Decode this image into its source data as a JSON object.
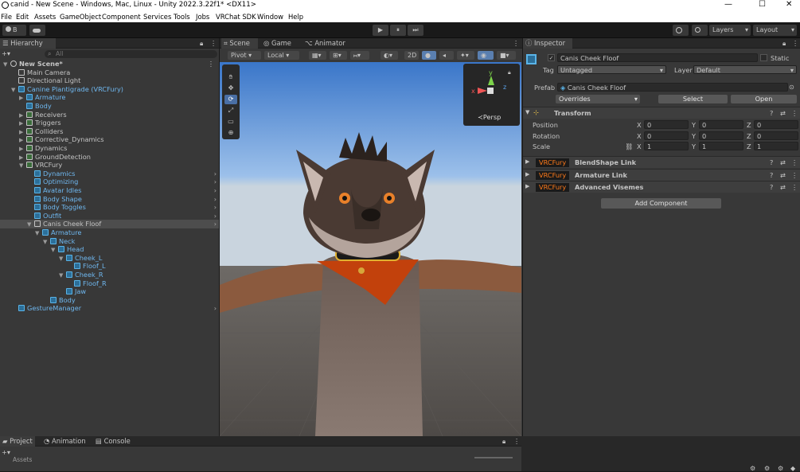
{
  "window": {
    "title": "canid - New Scene - Windows, Mac, Linux - Unity 2022.3.22f1* <DX11>",
    "min": "—",
    "max": "☐",
    "close": "✕"
  },
  "menu": [
    "File",
    "Edit",
    "Assets",
    "GameObject",
    "Component",
    "Services",
    "Tools",
    "Jobs",
    "VRChat SDK",
    "Window",
    "Help"
  ],
  "toolbar": {
    "account": "B",
    "layers": "Layers",
    "layout": "Layout",
    "play": "▶",
    "pause": "⏸",
    "step": "⏭"
  },
  "hierarchy": {
    "tab": "Hierarchy",
    "search_placeholder": "All",
    "add": "+▾",
    "rows": [
      {
        "label": "New Scene*",
        "depth": 0,
        "arrow": "▼",
        "icon": "unity",
        "bold": true
      },
      {
        "label": "Main Camera",
        "depth": 1,
        "arrow": "",
        "icon": "cube"
      },
      {
        "label": "Directional Light",
        "depth": 1,
        "arrow": "",
        "icon": "cube"
      },
      {
        "label": "Canine Plantigrade (VRCFury)",
        "depth": 1,
        "arrow": "▼",
        "icon": "prefab",
        "blue": true
      },
      {
        "label": "Armature",
        "depth": 2,
        "arrow": "▶",
        "icon": "cube",
        "blue": true
      },
      {
        "label": "Body",
        "depth": 2,
        "arrow": "",
        "icon": "cube",
        "blue": true
      },
      {
        "label": "Receivers",
        "depth": 2,
        "arrow": "▶",
        "icon": "grn"
      },
      {
        "label": "Triggers",
        "depth": 2,
        "arrow": "▶",
        "icon": "grn"
      },
      {
        "label": "Colliders",
        "depth": 2,
        "arrow": "▶",
        "icon": "grn"
      },
      {
        "label": "Corrective_Dynamics",
        "depth": 2,
        "arrow": "▶",
        "icon": "grn"
      },
      {
        "label": "Dynamics",
        "depth": 2,
        "arrow": "▶",
        "icon": "grn"
      },
      {
        "label": "GroundDetection",
        "depth": 2,
        "arrow": "▶",
        "icon": "grn"
      },
      {
        "label": "VRCFury",
        "depth": 2,
        "arrow": "▼",
        "icon": "grn"
      },
      {
        "label": "Dynamics",
        "depth": 3,
        "arrow": "",
        "icon": "prefab",
        "blue": true,
        "more": true
      },
      {
        "label": "Optimizing",
        "depth": 3,
        "arrow": "",
        "icon": "prefab",
        "blue": true,
        "more": true
      },
      {
        "label": "Avatar Idles",
        "depth": 3,
        "arrow": "",
        "icon": "prefab",
        "blue": true,
        "more": true
      },
      {
        "label": "Body Shape",
        "depth": 3,
        "arrow": "",
        "icon": "prefab",
        "blue": true,
        "more": true
      },
      {
        "label": "Body Toggles",
        "depth": 3,
        "arrow": "",
        "icon": "prefab",
        "blue": true,
        "more": true
      },
      {
        "label": "Outfit",
        "depth": 3,
        "arrow": "",
        "icon": "prefab",
        "blue": true,
        "more": true
      },
      {
        "label": "Canis Cheek Floof",
        "depth": 3,
        "arrow": "▼",
        "icon": "prefab",
        "selected": true,
        "more": true
      },
      {
        "label": "Armature",
        "depth": 4,
        "arrow": "▼",
        "icon": "cube",
        "blue": true
      },
      {
        "label": "Neck",
        "depth": 5,
        "arrow": "▼",
        "icon": "cube",
        "blue": true
      },
      {
        "label": "Head",
        "depth": 6,
        "arrow": "▼",
        "icon": "cube",
        "blue": true
      },
      {
        "label": "Cheek_L",
        "depth": 7,
        "arrow": "▼",
        "icon": "cube",
        "blue": true
      },
      {
        "label": "Floof_L",
        "depth": 8,
        "arrow": "",
        "icon": "cube",
        "blue": true
      },
      {
        "label": "Cheek_R",
        "depth": 7,
        "arrow": "▼",
        "icon": "cube",
        "blue": true
      },
      {
        "label": "Floof_R",
        "depth": 8,
        "arrow": "",
        "icon": "cube",
        "blue": true
      },
      {
        "label": "Jaw",
        "depth": 7,
        "arrow": "",
        "icon": "cube",
        "blue": true
      },
      {
        "label": "Body",
        "depth": 5,
        "arrow": "",
        "icon": "cube",
        "blue": true
      },
      {
        "label": "GestureManager",
        "depth": 1,
        "arrow": "",
        "icon": "prefab",
        "blue": true,
        "more": true
      }
    ]
  },
  "scene": {
    "tabs": [
      "Scene",
      "Game",
      "Animator"
    ],
    "pivot": "Pivot",
    "local": "Local",
    "mode2d": "2D",
    "persp": "≺Persp",
    "gizmo": {
      "y": "y",
      "x": "x",
      "z": "z"
    }
  },
  "inspector": {
    "tab": "Inspector",
    "object_name": "Canis Cheek Floof",
    "static": "Static",
    "tag_label": "Tag",
    "tag_value": "Untagged",
    "layer_label": "Layer",
    "layer_value": "Default",
    "prefab_label": "Prefab",
    "prefab_value": "Canis Cheek Floof",
    "overrides": "Overrides",
    "select": "Select",
    "open": "Open",
    "transform": {
      "title": "Transform",
      "rows": [
        {
          "label": "Position",
          "x": "0",
          "y": "0",
          "z": "0"
        },
        {
          "label": "Rotation",
          "x": "0",
          "y": "0",
          "z": "0"
        },
        {
          "label": "Scale",
          "x": "1",
          "y": "1",
          "z": "1"
        }
      ]
    },
    "components": [
      {
        "badge": "VRCFury",
        "name": "BlendShape Link"
      },
      {
        "badge": "VRCFury",
        "name": "Armature Link"
      },
      {
        "badge": "VRCFury",
        "name": "Advanced Visemes"
      }
    ],
    "add_component": "Add Component"
  },
  "bottom": {
    "tabs": [
      "Project",
      "Animation",
      "Console"
    ],
    "assets_label": "Assets"
  }
}
